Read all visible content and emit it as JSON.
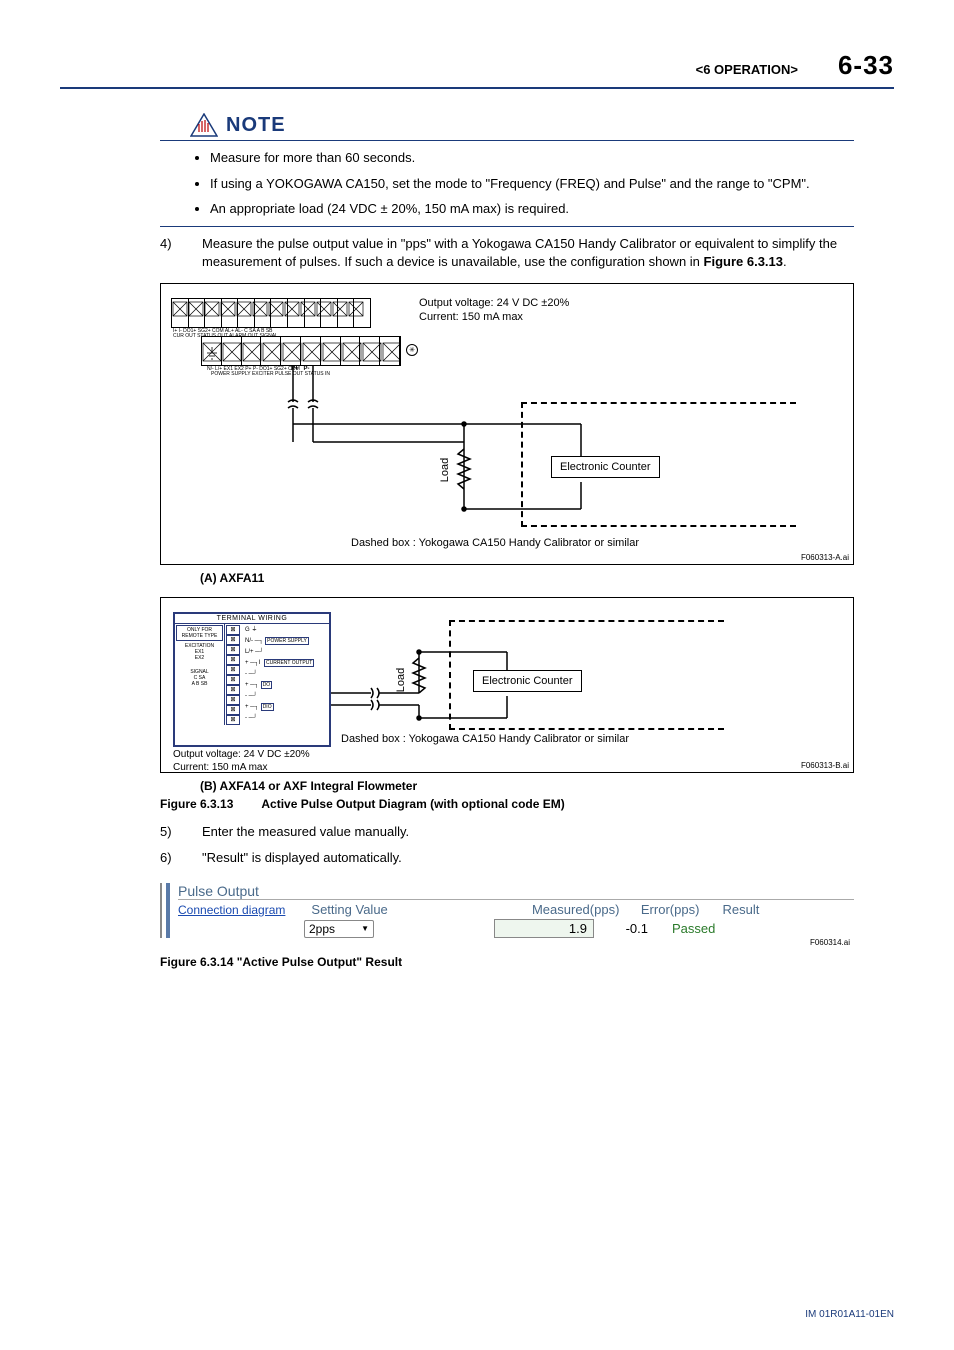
{
  "header": {
    "section": "<6  OPERATION>",
    "page": "6-33"
  },
  "note": {
    "label": "NOTE",
    "items": [
      "Measure for more than 60 seconds.",
      "If using a YOKOGAWA CA150, set the mode to \"Frequency (FREQ) and Pulse\" and the range to \"CPM\".",
      "An appropriate load (24 VDC ± 20%, 150 mA max) is required."
    ]
  },
  "step4": {
    "num": "4)",
    "text_a": "Measure the pulse output value in \"pps\" with a Yokogawa CA150 Handy Calibrator or equivalent to simplify the measurement of pulses. If such a device is unavailable, use the configuration shown in ",
    "bold": "Figure 6.3.13",
    "text_b": "."
  },
  "figA": {
    "out1": "Output voltage: 24 V DC ±20%",
    "out2": "Current: 150 mA max",
    "load": "Load",
    "counter": "Electronic Counter",
    "dashed": "Dashed box : Yokogawa CA150 Handy Calibrator or similar",
    "fn": "F060313-A.ai",
    "label": "(A) AXFA11",
    "toprow": "I+   I-   DO1+ SG2+ COM  AL+  AL-   C    SA    A     B    SB",
    "toprow2": "CUR OUT     STATUS OUT    ALARM OUT              SIGNAL",
    "botrow": "    N/-  L/+  EX1   EX2  P+   P-  DO1+  SG2+  COM",
    "botrow2": "POWER SUPPLY  EXCITER  PULSE OUT    STATUS IN"
  },
  "figB": {
    "tw": "TERMINAL WIRING",
    "tw_note": "ONLY FOR REMOTE TYPE",
    "rows_left": [
      "EXCITATION",
      "",
      "SIGNAL",
      ""
    ],
    "rows_r": [
      "EX1",
      "EX2",
      "C",
      "SA",
      "A",
      "B",
      "SB"
    ],
    "g": "G",
    "n": "N/-",
    "l": "L/+",
    "plus": "+",
    "minus": "-",
    "ps": "POWER SUPPLY",
    "cur": "CURRENT OUTPUT",
    "do": "DO",
    "dio": "DIO",
    "iout": "I",
    "load": "Load",
    "counter": "Electronic Counter",
    "dashed": "Dashed box : Yokogawa CA150 Handy Calibrator or similar",
    "out1": "Output voltage: 24 V DC ±20%",
    "out2": "Current: 150 mA   max",
    "fn": "F060313-B.ai",
    "label": "(B) AXFA14 or AXF Integral Flowmeter"
  },
  "fig_caption": {
    "num": "Figure 6.3.13",
    "text": "Active Pulse Output Diagram (with optional code EM)"
  },
  "step5": {
    "num": "5)",
    "text": "Enter the measured value manually."
  },
  "step6": {
    "num": "6)",
    "text": "\"Result\" is displayed automatically."
  },
  "pulse": {
    "title": "Pulse Output",
    "link": "Connection diagram",
    "setting_h": "Setting Value",
    "meas_h": "Measured(pps)",
    "err_h": "Error(pps)",
    "res_h": "Result",
    "select": "2pps",
    "meas_v": "1.9",
    "err_v": "-0.1",
    "res_v": "Passed",
    "fn": "F060314.ai"
  },
  "fig14_caption": "Figure 6.3.14 \"Active Pulse Output\" Result",
  "footer": "IM 01R01A11-01EN"
}
